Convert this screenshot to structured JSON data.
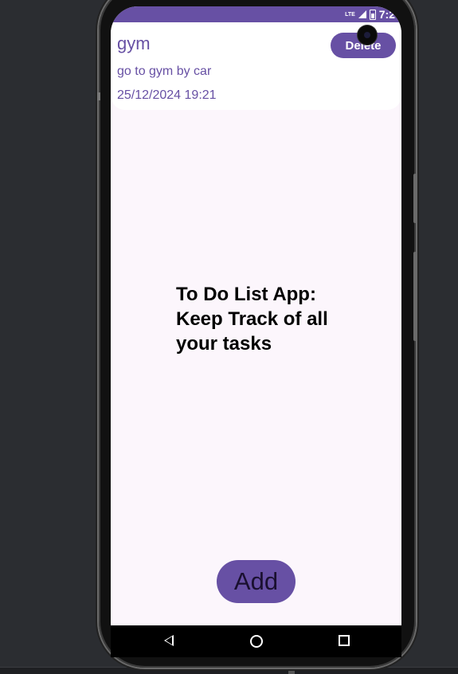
{
  "status_bar": {
    "network_label": "LTE",
    "time": "7:2"
  },
  "task": {
    "title": "gym",
    "description": "go to gym by car",
    "datetime": "25/12/2024 19:21",
    "delete_label": "Delete"
  },
  "main": {
    "heading": "To Do List App: Keep Track of all your tasks"
  },
  "add_label": "Add",
  "navigation": {
    "back_icon": "back-icon",
    "home_icon": "home-icon",
    "recents_icon": "recents-icon"
  },
  "colors": {
    "accent": "#6750a4",
    "screen_background": "#fcf6fc"
  }
}
